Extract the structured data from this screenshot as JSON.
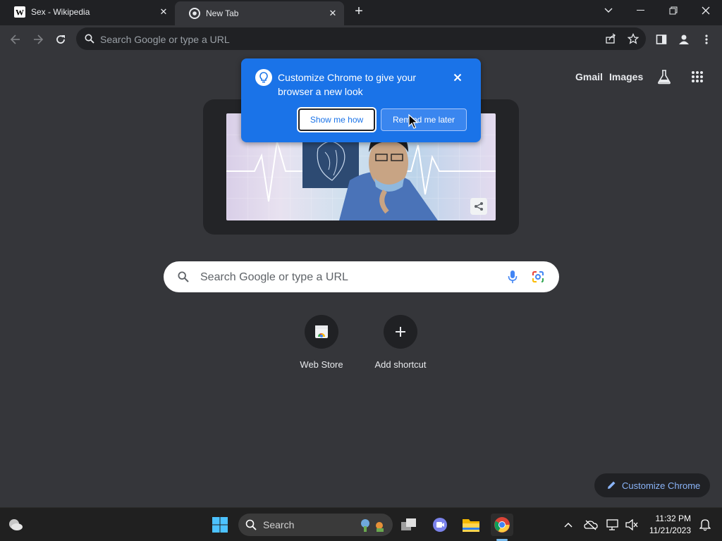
{
  "browser": {
    "tabs": [
      {
        "title": "Sex - Wikipedia",
        "favicon": "wikipedia-w-icon",
        "favicon_letter": "W"
      },
      {
        "title": "New Tab",
        "favicon": "chrome-icon"
      }
    ],
    "omnibox": {
      "placeholder": "Search Google or type a URL"
    }
  },
  "ntp": {
    "top_links": {
      "gmail": "Gmail",
      "images": "Images"
    },
    "search": {
      "placeholder": "Search Google or type a URL"
    },
    "shortcuts": [
      {
        "label": "Web Store",
        "icon": "web-store-icon"
      },
      {
        "label": "Add shortcut",
        "icon": "plus-icon"
      }
    ],
    "customize_button": "Customize Chrome"
  },
  "promo_bubble": {
    "text": "Customize Chrome to give your browser a new look",
    "primary_button": "Show me how",
    "secondary_button": "Remind me later"
  },
  "taskbar": {
    "search_label": "Search",
    "time": "11:32 PM",
    "date": "11/21/2023"
  },
  "colors": {
    "accent": "#1a73e8",
    "page_bg": "#35363a",
    "tabstrip_bg": "#202124",
    "link_blue": "#8ab4f8"
  }
}
